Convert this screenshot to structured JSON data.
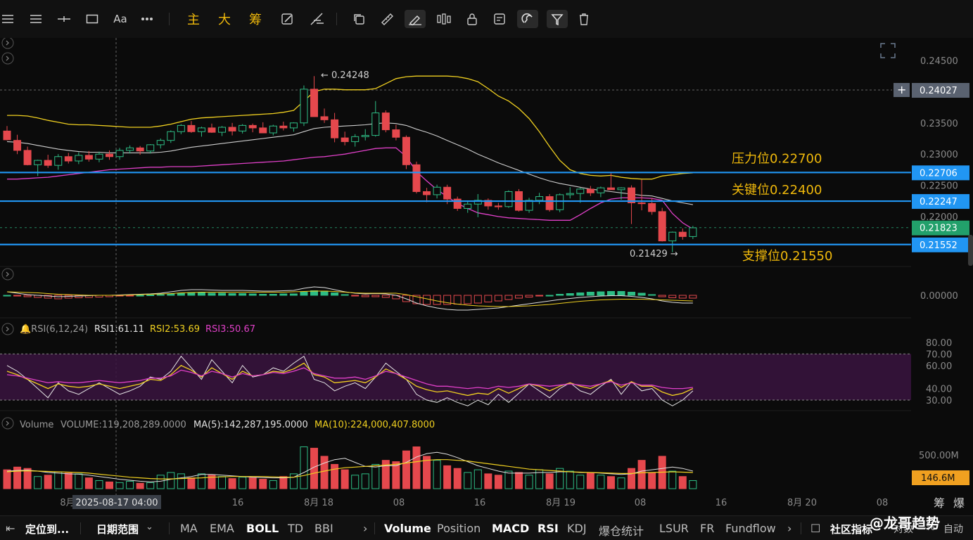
{
  "toolbar": {
    "icons": [
      "menu-icon",
      "lines-icon",
      "horizontal-line-icon",
      "rectangle-icon",
      "text-icon",
      "more-icon",
      "zhu-label",
      "da-label",
      "chou-label",
      "edit-icon",
      "measure-icon",
      "copy-icon",
      "ruler-icon",
      "draw-icon",
      "bars-icon",
      "lock-icon",
      "note-icon",
      "magnet-icon",
      "filter-icon",
      "delete-icon"
    ],
    "text_tool": "Aa",
    "cn_main": "主",
    "cn_big": "大",
    "cn_chip": "筹"
  },
  "annotations": {
    "resistance": "压力位0.22700",
    "key": "关键位0.22400",
    "support": "支撑位0.21550",
    "high_marker": "← 0.24248",
    "low_marker": "0.21429 →"
  },
  "price_labels": {
    "crosshair": "0.24027",
    "line1": "0.22706",
    "line2": "0.22247",
    "current": "0.21823",
    "line3": "0.21552",
    "volume_current": "146.6M"
  },
  "rsi_legend": {
    "name": "RSI(6,12,24)",
    "rsi1": "RSI1:61.11",
    "rsi2": "RSI2:53.69",
    "rsi3": "RSI3:50.67"
  },
  "vol_legend": {
    "name": "Volume",
    "volume": "VOLUME:119,208,289.0000",
    "ma5": "MA(5):142,287,195.0000",
    "ma10": "MA(10):224,000,407.8000"
  },
  "time_axis": {
    "crosshair_time": "2025-08-17 04:00",
    "ticks": [
      "8月",
      "16",
      "8月 18",
      "08",
      "16",
      "8月 19",
      "08",
      "16",
      "8月 20",
      "08"
    ],
    "right_tools": [
      "筹",
      "爆"
    ]
  },
  "bottom_bar": {
    "locate": "定位到...",
    "date_range": "日期范围",
    "indicators": [
      "MA",
      "EMA",
      "BOLL",
      "TD",
      "BBI"
    ],
    "sub_indicators": [
      "Volume",
      "Position",
      "MACD",
      "RSI",
      "KDJ",
      "爆仓统计",
      "LSUR",
      "FR",
      "Fundflow"
    ],
    "community": "社区指标",
    "log": "对数",
    "pct": "%",
    "auto": "自动",
    "watermark": "@龙哥趋势"
  },
  "colors": {
    "up": "#2ebd85",
    "down": "#e5484d",
    "line": "#2196f3",
    "ma_yellow": "#f0d020",
    "ma_pink": "#e040c8",
    "annot": "#f0b90b"
  },
  "chart_data": {
    "type": "candlestick",
    "price_axis": [
      "0.24500",
      "0.24000",
      "0.23500",
      "0.23000",
      "0.22500",
      "0.22000"
    ],
    "price_range": [
      0.2105,
      0.247
    ],
    "horizontal_lines": [
      0.22706,
      0.22247,
      0.21552
    ],
    "candles": [
      [
        0.2337,
        0.2345,
        0.2322,
        0.2323
      ],
      [
        0.2322,
        0.2331,
        0.23,
        0.2306
      ],
      [
        0.2306,
        0.2312,
        0.2282,
        0.2283
      ],
      [
        0.2283,
        0.2291,
        0.2265,
        0.229
      ],
      [
        0.229,
        0.2299,
        0.2278,
        0.2282
      ],
      [
        0.2282,
        0.23,
        0.2275,
        0.2296
      ],
      [
        0.2296,
        0.2302,
        0.2285,
        0.2289
      ],
      [
        0.2289,
        0.2303,
        0.2284,
        0.2298
      ],
      [
        0.2298,
        0.2305,
        0.2288,
        0.2292
      ],
      [
        0.2292,
        0.2304,
        0.2287,
        0.23
      ],
      [
        0.23,
        0.2306,
        0.2291,
        0.2296
      ],
      [
        0.2296,
        0.231,
        0.2291,
        0.2306
      ],
      [
        0.2306,
        0.2314,
        0.2301,
        0.231
      ],
      [
        0.231,
        0.2313,
        0.2299,
        0.2305
      ],
      [
        0.2305,
        0.2316,
        0.2301,
        0.2315
      ],
      [
        0.2315,
        0.2325,
        0.2309,
        0.2322
      ],
      [
        0.2322,
        0.2338,
        0.2318,
        0.2336
      ],
      [
        0.2336,
        0.2348,
        0.2332,
        0.2346
      ],
      [
        0.2346,
        0.2353,
        0.2334,
        0.2336
      ],
      [
        0.2336,
        0.2344,
        0.2328,
        0.2342
      ],
      [
        0.2342,
        0.2349,
        0.2334,
        0.2335
      ],
      [
        0.2335,
        0.2345,
        0.2329,
        0.2343
      ],
      [
        0.2343,
        0.235,
        0.233,
        0.2337
      ],
      [
        0.2337,
        0.2348,
        0.2333,
        0.2346
      ],
      [
        0.2346,
        0.2349,
        0.2335,
        0.2342
      ],
      [
        0.2342,
        0.2351,
        0.2336,
        0.2334
      ],
      [
        0.2334,
        0.2347,
        0.233,
        0.2345
      ],
      [
        0.2345,
        0.2352,
        0.2338,
        0.2342
      ],
      [
        0.2342,
        0.2351,
        0.2336,
        0.235
      ],
      [
        0.235,
        0.241,
        0.2345,
        0.2404
      ],
      [
        0.2404,
        0.2425,
        0.236,
        0.236
      ],
      [
        0.236,
        0.2373,
        0.235,
        0.2355
      ],
      [
        0.2355,
        0.2366,
        0.2319,
        0.2326
      ],
      [
        0.2326,
        0.2336,
        0.2314,
        0.232
      ],
      [
        0.232,
        0.2332,
        0.2312,
        0.2328
      ],
      [
        0.2328,
        0.234,
        0.2322,
        0.233
      ],
      [
        0.233,
        0.2385,
        0.2328,
        0.2366
      ],
      [
        0.2366,
        0.237,
        0.2335,
        0.2339
      ],
      [
        0.2339,
        0.2347,
        0.2322,
        0.2327
      ],
      [
        0.2327,
        0.233,
        0.2276,
        0.2283
      ],
      [
        0.2283,
        0.2288,
        0.2237,
        0.224
      ],
      [
        0.224,
        0.2246,
        0.2223,
        0.2235
      ],
      [
        0.2235,
        0.2251,
        0.2229,
        0.2247
      ],
      [
        0.2247,
        0.2251,
        0.222,
        0.2228
      ],
      [
        0.2228,
        0.2232,
        0.2209,
        0.2213
      ],
      [
        0.2213,
        0.2224,
        0.2206,
        0.222
      ],
      [
        0.222,
        0.2236,
        0.2199,
        0.2226
      ],
      [
        0.2226,
        0.2229,
        0.2211,
        0.2217
      ],
      [
        0.2217,
        0.2222,
        0.2211,
        0.2216
      ],
      [
        0.2216,
        0.2242,
        0.2214,
        0.224
      ],
      [
        0.224,
        0.2244,
        0.2208,
        0.221
      ],
      [
        0.221,
        0.223,
        0.2206,
        0.2226
      ],
      [
        0.2226,
        0.2238,
        0.222,
        0.2232
      ],
      [
        0.2232,
        0.2236,
        0.2208,
        0.2211
      ],
      [
        0.2211,
        0.2237,
        0.2207,
        0.2235
      ],
      [
        0.2235,
        0.2247,
        0.2229,
        0.2237
      ],
      [
        0.2237,
        0.2246,
        0.2222,
        0.2244
      ],
      [
        0.2244,
        0.2249,
        0.2233,
        0.2238
      ],
      [
        0.2238,
        0.2248,
        0.2231,
        0.2246
      ],
      [
        0.2246,
        0.2271,
        0.2243,
        0.2243
      ],
      [
        0.2243,
        0.2247,
        0.2227,
        0.2246
      ],
      [
        0.2246,
        0.225,
        0.2188,
        0.2222
      ],
      [
        0.2222,
        0.2259,
        0.221,
        0.2221
      ],
      [
        0.2221,
        0.223,
        0.2203,
        0.2208
      ],
      [
        0.2208,
        0.2214,
        0.216,
        0.2161
      ],
      [
        0.2161,
        0.2176,
        0.2143,
        0.2175
      ],
      [
        0.2175,
        0.2181,
        0.2163,
        0.2168
      ],
      [
        0.2168,
        0.2185,
        0.2164,
        0.2182
      ]
    ],
    "bollinger": {
      "upper": [
        0.2362,
        0.2362,
        0.2361,
        0.2358,
        0.2354,
        0.2351,
        0.2348,
        0.2347,
        0.2347,
        0.2346,
        0.2345,
        0.2344,
        0.2343,
        0.2343,
        0.2343,
        0.2345,
        0.2348,
        0.2352,
        0.2356,
        0.2358,
        0.2359,
        0.236,
        0.2361,
        0.2362,
        0.2363,
        0.2364,
        0.2365,
        0.2367,
        0.237,
        0.2385,
        0.24,
        0.2404,
        0.2404,
        0.2403,
        0.2403,
        0.2403,
        0.2405,
        0.2413,
        0.2421,
        0.2424,
        0.2425,
        0.2425,
        0.2425,
        0.2425,
        0.2424,
        0.2421,
        0.2416,
        0.2405,
        0.2393,
        0.2385,
        0.2373,
        0.2357,
        0.2336,
        0.2312,
        0.229,
        0.2275,
        0.2269,
        0.2266,
        0.2265,
        0.2266,
        0.2263,
        0.2261,
        0.226,
        0.226,
        0.2265,
        0.2267,
        0.2269,
        0.227
      ],
      "middle": [
        0.232,
        0.2319,
        0.2317,
        0.2314,
        0.2311,
        0.2308,
        0.2306,
        0.2304,
        0.2303,
        0.2303,
        0.2302,
        0.2302,
        0.2302,
        0.2302,
        0.2302,
        0.2303,
        0.2305,
        0.2308,
        0.2311,
        0.2313,
        0.2315,
        0.2317,
        0.2319,
        0.2321,
        0.2323,
        0.2325,
        0.2327,
        0.2329,
        0.2331,
        0.2336,
        0.2341,
        0.2343,
        0.2344,
        0.2345,
        0.2346,
        0.2347,
        0.2349,
        0.235,
        0.2349,
        0.2346,
        0.234,
        0.2335,
        0.2329,
        0.2322,
        0.2315,
        0.2308,
        0.23,
        0.2293,
        0.2286,
        0.228,
        0.2274,
        0.2268,
        0.2262,
        0.2257,
        0.2253,
        0.225,
        0.2247,
        0.2244,
        0.2242,
        0.224,
        0.2238,
        0.2236,
        0.2234,
        0.2233,
        0.2229,
        0.2225,
        0.2222,
        0.2219
      ],
      "lower": [
        0.226,
        0.226,
        0.2261,
        0.2262,
        0.2263,
        0.2265,
        0.2267,
        0.2269,
        0.2271,
        0.2273,
        0.2275,
        0.2276,
        0.2277,
        0.2278,
        0.2279,
        0.2279,
        0.228,
        0.228,
        0.228,
        0.2281,
        0.2282,
        0.2283,
        0.2284,
        0.2285,
        0.2286,
        0.2287,
        0.2288,
        0.2289,
        0.2291,
        0.2293,
        0.2295,
        0.2296,
        0.2298,
        0.23,
        0.2303,
        0.2306,
        0.2309,
        0.231,
        0.231,
        0.2296,
        0.2272,
        0.2257,
        0.2243,
        0.2232,
        0.2221,
        0.2213,
        0.2206,
        0.2203,
        0.22,
        0.2198,
        0.2197,
        0.2196,
        0.2195,
        0.2194,
        0.2194,
        0.2194,
        0.2203,
        0.2213,
        0.2222,
        0.2228,
        0.223,
        0.223,
        0.223,
        0.2229,
        0.2226,
        0.2205,
        0.219,
        0.218
      ]
    },
    "macd": {
      "zero_label": "0.00000",
      "hist": [
        0.0,
        -0.1,
        -0.2,
        -0.3,
        -0.4,
        -0.5,
        -0.4,
        -0.35,
        -0.3,
        -0.25,
        -0.2,
        -0.1,
        -0.05,
        0.0,
        0.05,
        0.1,
        0.2,
        0.3,
        0.4,
        0.35,
        0.3,
        0.3,
        0.25,
        0.25,
        0.2,
        0.15,
        0.15,
        0.2,
        0.2,
        0.45,
        0.65,
        0.6,
        0.35,
        0.1,
        -0.1,
        -0.2,
        -0.2,
        -0.3,
        -0.5,
        -0.9,
        -1.2,
        -1.3,
        -1.3,
        -1.3,
        -1.25,
        -1.2,
        -1.1,
        -0.95,
        -0.8,
        -0.6,
        -0.4,
        -0.25,
        -0.1,
        0.0,
        0.15,
        0.25,
        0.35,
        0.45,
        0.5,
        0.55,
        0.55,
        0.45,
        0.3,
        0.1,
        -0.2,
        -0.35,
        -0.4,
        -0.4
      ],
      "dif": [
        0.5,
        0.3,
        0.1,
        0.0,
        -0.1,
        -0.2,
        -0.15,
        -0.1,
        -0.05,
        0.0,
        0.0,
        0.05,
        0.1,
        0.15,
        0.2,
        0.3,
        0.5,
        0.7,
        0.8,
        0.8,
        0.75,
        0.7,
        0.7,
        0.7,
        0.65,
        0.6,
        0.6,
        0.65,
        0.7,
        1.0,
        1.2,
        1.1,
        0.8,
        0.5,
        0.3,
        0.2,
        0.25,
        0.2,
        0.0,
        -0.5,
        -1.1,
        -1.5,
        -1.8,
        -2.0,
        -2.1,
        -2.1,
        -2.0,
        -1.9,
        -1.8,
        -1.6,
        -1.4,
        -1.2,
        -1.0,
        -0.8,
        -0.6,
        -0.45,
        -0.3,
        -0.2,
        -0.1,
        -0.05,
        -0.05,
        -0.15,
        -0.3,
        -0.5,
        -0.8,
        -1.0,
        -1.1,
        -1.1
      ],
      "dea": [
        0.5,
        0.45,
        0.4,
        0.35,
        0.25,
        0.15,
        0.1,
        0.05,
        0.0,
        0.0,
        0.0,
        0.0,
        0.05,
        0.1,
        0.15,
        0.2,
        0.25,
        0.35,
        0.4,
        0.45,
        0.45,
        0.45,
        0.45,
        0.45,
        0.45,
        0.45,
        0.45,
        0.45,
        0.5,
        0.55,
        0.6,
        0.6,
        0.55,
        0.45,
        0.35,
        0.3,
        0.3,
        0.3,
        0.3,
        0.1,
        -0.2,
        -0.5,
        -0.8,
        -1.05,
        -1.25,
        -1.4,
        -1.5,
        -1.55,
        -1.6,
        -1.6,
        -1.55,
        -1.5,
        -1.4,
        -1.3,
        -1.15,
        -1.0,
        -0.85,
        -0.75,
        -0.65,
        -0.6,
        -0.55,
        -0.55,
        -0.55,
        -0.6,
        -0.65,
        -0.7,
        -0.75,
        -0.8
      ]
    },
    "rsi": {
      "axis": [
        "80.00",
        "70.00",
        "60.00",
        "40.00",
        "30.00"
      ],
      "band": [
        30,
        70
      ],
      "rsi1": [
        60,
        55,
        48,
        40,
        32,
        45,
        38,
        35,
        40,
        45,
        40,
        35,
        38,
        42,
        50,
        48,
        55,
        68,
        58,
        48,
        65,
        55,
        45,
        60,
        50,
        52,
        58,
        55,
        62,
        68,
        48,
        45,
        38,
        42,
        45,
        40,
        50,
        62,
        55,
        48,
        35,
        30,
        28,
        32,
        28,
        25,
        30,
        26,
        35,
        28,
        36,
        44,
        38,
        32,
        40,
        45,
        38,
        35,
        42,
        48,
        35,
        46,
        38,
        40,
        30,
        25,
        30,
        38
      ],
      "rsi2": [
        55,
        52,
        48,
        44,
        40,
        44,
        42,
        41,
        42,
        44,
        42,
        40,
        42,
        44,
        48,
        47,
        52,
        60,
        56,
        50,
        58,
        53,
        48,
        55,
        51,
        52,
        55,
        54,
        57,
        62,
        52,
        50,
        45,
        46,
        47,
        45,
        50,
        57,
        53,
        48,
        42,
        39,
        37,
        38,
        36,
        34,
        36,
        35,
        40,
        36,
        40,
        44,
        42,
        38,
        42,
        45,
        42,
        40,
        44,
        47,
        41,
        46,
        42,
        42,
        37,
        34,
        36,
        40
      ],
      "rsi3": [
        52,
        51,
        49,
        47,
        45,
        46,
        45,
        45,
        46,
        47,
        46,
        45,
        46,
        47,
        49,
        49,
        51,
        56,
        54,
        51,
        55,
        53,
        50,
        53,
        51,
        52,
        54,
        53,
        55,
        58,
        53,
        51,
        49,
        49,
        50,
        48,
        51,
        55,
        53,
        50,
        47,
        44,
        42,
        42,
        41,
        40,
        41,
        40,
        42,
        41,
        42,
        44,
        43,
        42,
        43,
        44,
        43,
        42,
        44,
        46,
        43,
        45,
        43,
        43,
        41,
        40,
        40,
        41
      ]
    },
    "volume": {
      "axis": [
        "500.00M"
      ],
      "values": [
        280,
        320,
        300,
        180,
        200,
        250,
        230,
        220,
        160,
        120,
        100,
        90,
        110,
        80,
        90,
        200,
        240,
        220,
        160,
        220,
        200,
        180,
        150,
        170,
        160,
        140,
        120,
        180,
        220,
        620,
        600,
        480,
        360,
        280,
        200,
        220,
        360,
        420,
        400,
        560,
        620,
        480,
        420,
        340,
        300,
        240,
        280,
        220,
        200,
        260,
        240,
        200,
        280,
        220,
        300,
        260,
        200,
        240,
        200,
        180,
        160,
        300,
        420,
        240,
        480,
        260,
        180,
        120
      ],
      "ma5": [
        260,
        270,
        275,
        260,
        240,
        230,
        220,
        215,
        200,
        180,
        160,
        140,
        125,
        110,
        100,
        110,
        140,
        160,
        180,
        210,
        210,
        200,
        190,
        180,
        170,
        165,
        160,
        160,
        170,
        240,
        320,
        380,
        430,
        450,
        390,
        330,
        320,
        340,
        340,
        390,
        470,
        520,
        540,
        510,
        460,
        400,
        340,
        300,
        260,
        230,
        230,
        230,
        240,
        240,
        250,
        250,
        240,
        240,
        230,
        220,
        210,
        220,
        260,
        280,
        300,
        320,
        300,
        260
      ],
      "ma10": [
        250,
        260,
        265,
        260,
        255,
        250,
        245,
        240,
        230,
        215,
        200,
        185,
        170,
        160,
        150,
        145,
        145,
        150,
        155,
        160,
        170,
        175,
        180,
        180,
        180,
        180,
        175,
        170,
        170,
        195,
        230,
        260,
        290,
        310,
        320,
        330,
        340,
        350,
        360,
        380,
        400,
        420,
        430,
        430,
        420,
        410,
        390,
        370,
        350,
        330,
        310,
        290,
        280,
        270,
        260,
        250,
        245,
        240,
        235,
        230,
        225,
        225,
        235,
        240,
        245,
        250,
        245,
        240
      ]
    }
  }
}
